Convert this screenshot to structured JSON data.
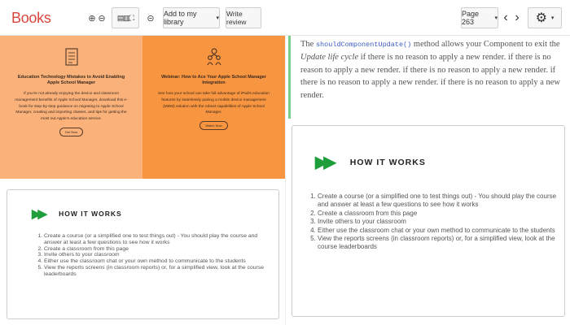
{
  "toolbar": {
    "brand": "Books",
    "zoom_in_icon": "⊕",
    "zoom_out_icon": "⊖",
    "view_icons": "▤▥⛶",
    "link_icon": "⊝",
    "add_library_label": "Add to my library",
    "add_library_caret": "▾",
    "write_review_label": "Write review",
    "page_label": "Page 263",
    "page_caret": "▾",
    "prev_icon": "‹",
    "next_icon": "›",
    "gear_icon": "⚙",
    "gear_caret": "▾"
  },
  "left": {
    "cards": [
      {
        "icon": "checklist-icon",
        "title": "Education Technology Mistakes to Avoid Enabling Apple School Manager",
        "body": "If you're not already enjoying the device and classroom management benefits of Apple School Manager, download this e-book for step-by-step guidance on migrating to Apple School Manager, creating and importing classes, and tips for getting the most out Apple's education service.",
        "button": "Get Now",
        "color": "#fbb27a"
      },
      {
        "icon": "people-icon",
        "title": "Webinar: How to Ace Your Apple School Manager Integration",
        "body": "See how your school can take full advantage of iPad's education features by seamlessly pairing a mobile device management (MDM) solution with the robust capabilities of Apple School Manager.",
        "button": "Watch Now",
        "color": "#f79540"
      }
    ],
    "how_it_works": {
      "title": "HOW IT WORKS",
      "arrows": "▶▶",
      "items": [
        "Create a course (or a simplified one to test things out) - You should play the course and answer at least a few questions to see how it works",
        "Create a classroom from this page",
        "Invite others to your classroom",
        "Either use the classroom chat or your own method to communicate to the students",
        "View the reports screens (in classroom reports) or, for a simplified view, look at the course leaderboards"
      ]
    }
  },
  "right": {
    "text_prefix": "The ",
    "code": "shouldComponentUpdate()",
    "text_mid": " method allows your Component to exit the ",
    "em": "Update life cycle",
    "text_suffix": " if there is no reason to apply a new render. if there is no reason to apply a new render. if there is no reason to apply a new render. if there is no reason to apply a new render. if there is no reason to apply a new render.",
    "how_it_works": {
      "title": "HOW IT WORKS",
      "arrows": "▶▶",
      "items": [
        "Create a course (or a simplified one to test things out) - You should play the course and answer at least a few questions to see how it works",
        "Create a classroom from this page",
        "Invite others to your classroom",
        "Either use the classroom chat or your own method to communicate to the students",
        "View the reports screens (in classroom reports) or, for a simplified view, look at the course leaderboards"
      ]
    }
  }
}
